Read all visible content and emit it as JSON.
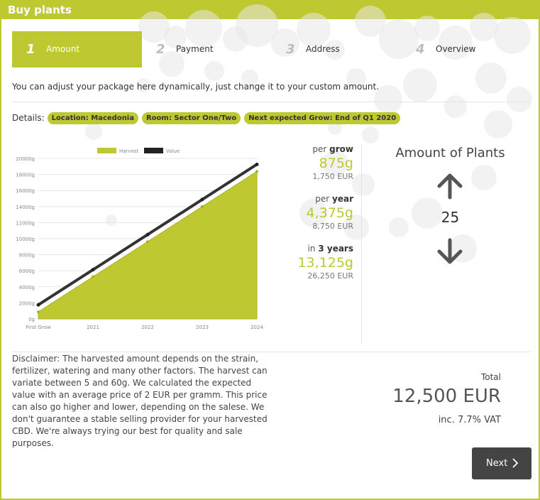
{
  "header": {
    "title": "Buy plants"
  },
  "steps": [
    {
      "num": "1",
      "label": "Amount"
    },
    {
      "num": "2",
      "label": "Payment"
    },
    {
      "num": "3",
      "label": "Address"
    },
    {
      "num": "4",
      "label": "Overview"
    }
  ],
  "active_step": "Amount",
  "intro": "You can adjust your package here dynamically, just change it to your custom amount.",
  "details": {
    "label": "Details:",
    "tags": [
      "Location: Macedonia",
      "Room: Sector One/Two",
      "Next expected Grow: End of Q1 2020"
    ]
  },
  "stats": {
    "grow": {
      "prefix": "per",
      "unit": "grow",
      "weight": "875g",
      "eur": "1,750 EUR"
    },
    "year": {
      "prefix": "per",
      "unit": "year",
      "weight": "4,375g",
      "eur": "8,750 EUR"
    },
    "three_years": {
      "prefix": "in",
      "unit": "3 years",
      "weight": "13,125g",
      "eur": "26,250 EUR"
    }
  },
  "amount": {
    "title": "Amount of Plants",
    "value": "25",
    "up_icon": "arrow-up-icon",
    "down_icon": "arrow-down-icon"
  },
  "disclaimer": "Disclaimer: The harvested amount depends on the strain, fertilizer, watering and many other factors. The harvest can variate between 5 and 60g. We calculated the expected value with an average price of 2 EUR per gramm. This price can also go higher and lower, depending on the salese. We don't guarantee a stable selling provider for your harvested CBD. We're always trying our best for quality and sale purposes.",
  "total": {
    "label": "Total",
    "value": "12,500 EUR",
    "vat": "inc. 7.7% VAT"
  },
  "next_button": {
    "label": "Next",
    "icon": "chevron-right-icon"
  },
  "colors": {
    "accent": "#bec830",
    "dark": "#444444",
    "value_line": "#333333"
  },
  "chart_data": {
    "type": "area",
    "categories": [
      "First Grow",
      "2021",
      "2022",
      "2023",
      "2024"
    ],
    "series": [
      {
        "name": "Harvest",
        "type": "area",
        "values": [
          875,
          5250,
          9625,
          14000,
          18375
        ]
      },
      {
        "name": "Value",
        "type": "line",
        "values": [
          1750,
          6125,
          10500,
          14875,
          19250
        ]
      }
    ],
    "yticks": [
      "0g",
      "2000g",
      "4000g",
      "6000g",
      "8000g",
      "10000g",
      "12000g",
      "14000g",
      "16000g",
      "18000g",
      "20000g"
    ],
    "ylim": [
      0,
      20000
    ],
    "legend": "top"
  }
}
